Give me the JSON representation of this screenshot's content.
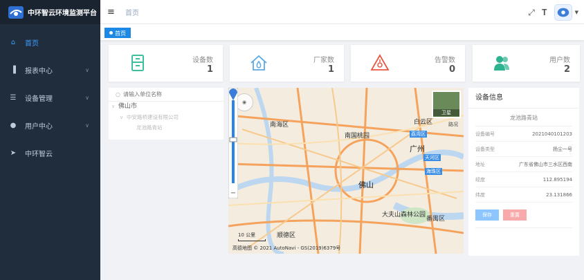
{
  "app": {
    "title": "中环智云环境监测平台"
  },
  "sidebar": {
    "items": [
      {
        "label": "首页",
        "icon": "home-icon",
        "active": true,
        "expandable": false
      },
      {
        "label": "报表中心",
        "icon": "bar-chart-icon",
        "active": false,
        "expandable": true
      },
      {
        "label": "设备管理",
        "icon": "sliders-icon",
        "active": false,
        "expandable": true
      },
      {
        "label": "用户中心",
        "icon": "users-icon",
        "active": false,
        "expandable": true
      },
      {
        "label": "中环智云",
        "icon": "send-icon",
        "active": false,
        "expandable": false
      }
    ]
  },
  "header": {
    "breadcrumb": "首页"
  },
  "tags": {
    "current": "首页"
  },
  "stats": [
    {
      "label": "设备数",
      "value": "1",
      "icon": "cabinet-icon",
      "color": "#3cbf9c"
    },
    {
      "label": "厂家数",
      "value": "1",
      "icon": "house-drop-icon",
      "color": "#5aa9e6"
    },
    {
      "label": "告警数",
      "value": "0",
      "icon": "warning-triangle-icon",
      "color": "#e9563f"
    },
    {
      "label": "用户数",
      "value": "2",
      "icon": "user-group-icon",
      "color": "#2eb391"
    }
  ],
  "tree": {
    "placeholder": "请输入单位名称",
    "root": "佛山市",
    "child": "中安路桥建设有限公司",
    "leaf": "龙池路青站"
  },
  "map": {
    "labels": [
      "广州",
      "佛山",
      "南海区",
      "天河区",
      "荔湾区",
      "海珠区",
      "白云区",
      "番禺区",
      "顺德区",
      "大夫山森林公园",
      "南国桃园"
    ],
    "road_label": "卫星\n路况",
    "satellite": "卫星",
    "scale": "10 公里",
    "copyright": "高德地图 © 2021 AutoNavi - GS(2019)6379号"
  },
  "info": {
    "title": "设备信息",
    "station": "龙池路青站",
    "rows": [
      {
        "key": "设备编号",
        "value": "2021040101203"
      },
      {
        "key": "设备类型",
        "value": "扬尘一号"
      },
      {
        "key": "地址",
        "value": "广东省佛山市三水区西南"
      },
      {
        "key": "经度",
        "value": "112.895194"
      },
      {
        "key": "纬度",
        "value": "23.131866"
      }
    ],
    "save_label": "保存",
    "reset_label": "重置"
  },
  "colors": {
    "sidebar": "#1f2d3d",
    "accent": "#1e88e5"
  }
}
